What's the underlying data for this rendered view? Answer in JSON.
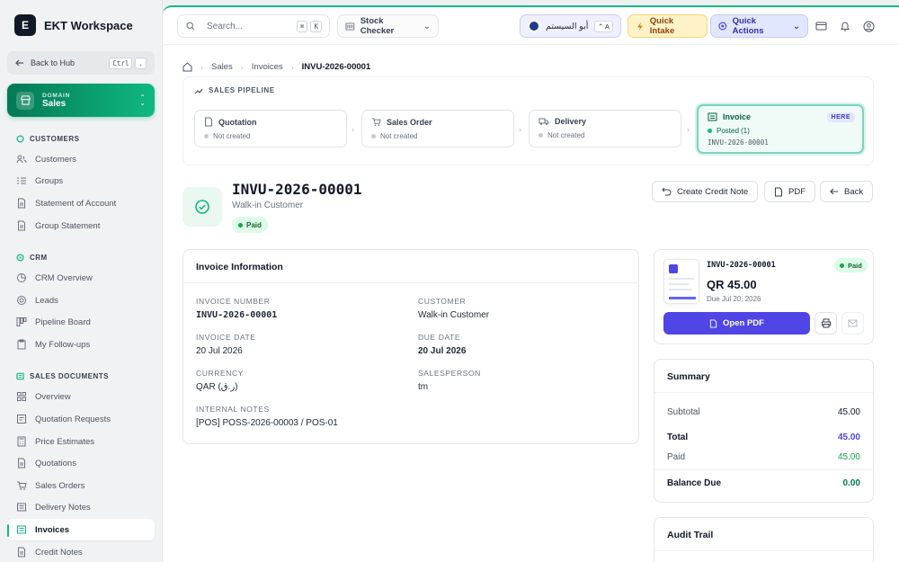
{
  "brand": {
    "logo_letter": "E",
    "name": "EKT Workspace"
  },
  "hub": {
    "label": "Back to Hub",
    "kbd": [
      "Ctrl",
      "."
    ]
  },
  "domain": {
    "label": "DOMAIN",
    "name": "Sales"
  },
  "sidebar": {
    "sections": [
      {
        "title": "CUSTOMERS",
        "items": [
          {
            "label": "Customers",
            "icon": "users-icon"
          },
          {
            "label": "Groups",
            "icon": "list-icon"
          },
          {
            "label": "Statement of Account",
            "icon": "document-icon"
          },
          {
            "label": "Group Statement",
            "icon": "document-icon"
          }
        ]
      },
      {
        "title": "CRM",
        "items": [
          {
            "label": "CRM Overview",
            "icon": "chart-icon"
          },
          {
            "label": "Leads",
            "icon": "target-icon"
          },
          {
            "label": "Pipeline Board",
            "icon": "kanban-icon"
          },
          {
            "label": "My Follow-ups",
            "icon": "clipboard-icon"
          }
        ]
      },
      {
        "title": "SALES DOCUMENTS",
        "items": [
          {
            "label": "Overview",
            "icon": "grid-icon"
          },
          {
            "label": "Quotation Requests",
            "icon": "request-icon"
          },
          {
            "label": "Price Estimates",
            "icon": "calculator-icon"
          },
          {
            "label": "Quotations",
            "icon": "document-icon"
          },
          {
            "label": "Sales Orders",
            "icon": "cart-icon"
          },
          {
            "label": "Delivery Notes",
            "icon": "truck-icon"
          },
          {
            "label": "Invoices",
            "icon": "invoice-icon",
            "active": true
          },
          {
            "label": "Credit Notes",
            "icon": "credit-icon"
          }
        ]
      }
    ]
  },
  "topbar": {
    "search_placeholder": "Search...",
    "search_kbd": [
      "⌘",
      "K"
    ],
    "stock_checker": "Stock Checker",
    "user_name": "أبو السيستم",
    "user_kbd": "⌃ A",
    "quick_intake": "Quick Intake",
    "quick_actions": "Quick Actions"
  },
  "breadcrumb": [
    "Sales",
    "Invoices",
    "INVU-2026-00001"
  ],
  "pipeline": {
    "title": "SALES PIPELINE",
    "stages": [
      {
        "name": "Quotation",
        "status": "Not created"
      },
      {
        "name": "Sales Order",
        "status": "Not created"
      },
      {
        "name": "Delivery",
        "status": "Not created"
      },
      {
        "name": "Invoice",
        "status": "Posted (1)",
        "badge": "HERE",
        "doc": "INVU-2026-00001"
      }
    ]
  },
  "invoice": {
    "number": "INVU-2026-00001",
    "customer": "Walk-in Customer",
    "status": "Paid",
    "actions": {
      "credit_note": "Create Credit Note",
      "pdf": "PDF",
      "back": "Back"
    }
  },
  "info": {
    "title": "Invoice Information",
    "fields": {
      "invoice_number": {
        "label": "INVOICE NUMBER",
        "value": "INVU-2026-00001"
      },
      "customer": {
        "label": "CUSTOMER",
        "value": "Walk-in Customer"
      },
      "invoice_date": {
        "label": "INVOICE DATE",
        "value": "20 Jul 2026"
      },
      "due_date": {
        "label": "DUE DATE",
        "value": "20 Jul 2026"
      },
      "currency": {
        "label": "CURRENCY",
        "value": "QAR (ر.ق)"
      },
      "salesperson": {
        "label": "SALESPERSON",
        "value": "tm"
      },
      "internal_notes": {
        "label": "INTERNAL NOTES",
        "value": "[POS] POSS-2026-00003 / POS-01"
      }
    }
  },
  "pdf_card": {
    "number": "INVU-2026-00001",
    "status": "Paid",
    "amount": "QR 45.00",
    "due": "Due Jul 20, 2026",
    "open_label": "Open PDF"
  },
  "summary": {
    "title": "Summary",
    "subtotal_label": "Subtotal",
    "subtotal": "45.00",
    "total_label": "Total",
    "total": "45.00",
    "paid_label": "Paid",
    "paid": "45.00",
    "balance_label": "Balance Due",
    "balance": "0.00"
  },
  "audit": {
    "title": "Audit Trail"
  },
  "colors": {
    "accent_green": "#10b981",
    "accent_indigo": "#4f46e5",
    "total_color": "#4f46e5",
    "paid_color": "#16a34a"
  }
}
